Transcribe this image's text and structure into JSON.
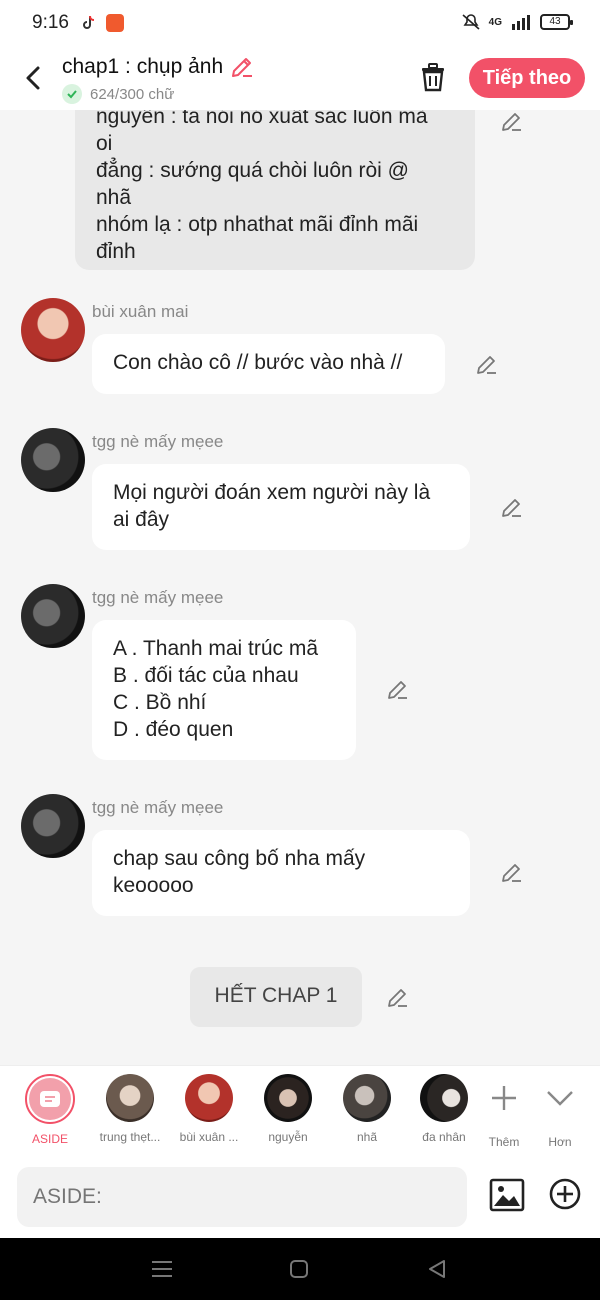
{
  "status_bar": {
    "time": "9:16",
    "network": "4G",
    "battery": "43"
  },
  "header": {
    "title": "chap1 : chụp ảnh",
    "word_count": "624/300 chữ",
    "next_label": "Tiếp theo"
  },
  "messages": {
    "partial": {
      "lines": [
        "nguyễn : ta nói nó xuất sắc luôn mà",
        "oi",
        "đẳng : sướng quá chòi luôn ròi @",
        "nhã",
        "nhóm lạ : otp nhathat mãi đỉnh mãi",
        "đỉnh"
      ]
    },
    "m1": {
      "sender": "bùi xuân mai",
      "text": "Con chào cô // bước vào nhà //"
    },
    "m2": {
      "sender": "tgg nè mấy mẹee",
      "text": "Mọi người đoán xem người này là ai đây"
    },
    "m3": {
      "sender": "tgg nè mấy mẹee",
      "lines": [
        "A . Thanh mai trúc mã",
        "B . đối tác của nhau",
        "C . Bồ nhí",
        "D . đéo quen"
      ]
    },
    "m4": {
      "sender": "tgg nè mấy mẹee",
      "text": "chap sau công bố nha mấy keooooo"
    },
    "end": "HẾT CHAP 1"
  },
  "characters": [
    {
      "label": "ASIDE"
    },
    {
      "label": "trung thẹt..."
    },
    {
      "label": "bùi xuân ..."
    },
    {
      "label": "nguyễn"
    },
    {
      "label": "nhã"
    },
    {
      "label": "đa nhân"
    }
  ],
  "actions": {
    "add_label": "Thêm",
    "more_label": "Hơn"
  },
  "input": {
    "placeholder": "ASIDE:"
  },
  "colors": {
    "accent": "#f25168",
    "bubble": "#ffffff",
    "background": "#f5f5f5"
  }
}
